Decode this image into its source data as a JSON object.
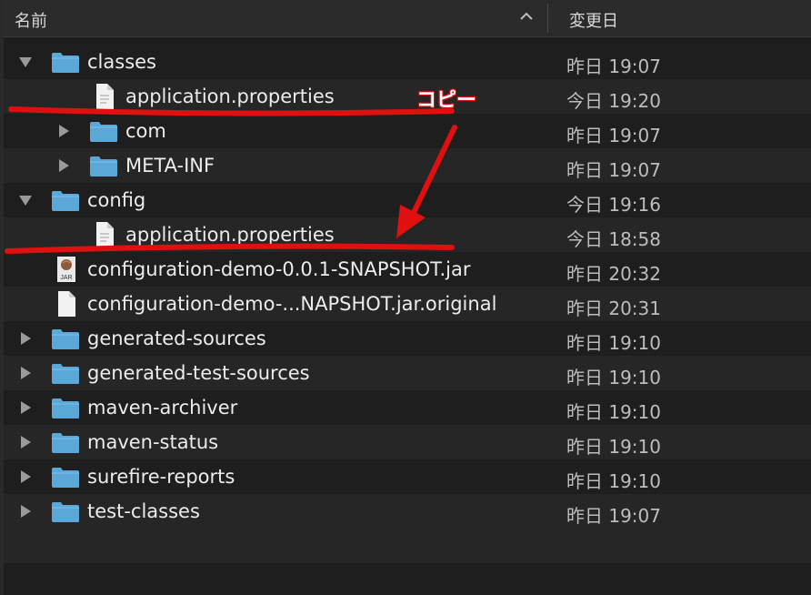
{
  "header": {
    "name_col": "名前",
    "date_col": "変更日"
  },
  "rows": [
    {
      "name": "classes",
      "date": "昨日 19:07"
    },
    {
      "name": "application.properties",
      "date": "今日 19:20"
    },
    {
      "name": "com",
      "date": "昨日 19:07"
    },
    {
      "name": "META-INF",
      "date": "昨日 19:07"
    },
    {
      "name": "config",
      "date": "今日 19:16"
    },
    {
      "name": "application.properties",
      "date": "今日 18:58"
    },
    {
      "name": "configuration-demo-0.0.1-SNAPSHOT.jar",
      "date": "昨日 20:32"
    },
    {
      "name": "configuration-demo-...NAPSHOT.jar.original",
      "date": "昨日 20:31"
    },
    {
      "name": "generated-sources",
      "date": "昨日 19:10"
    },
    {
      "name": "generated-test-sources",
      "date": "昨日 19:10"
    },
    {
      "name": "maven-archiver",
      "date": "昨日 19:10"
    },
    {
      "name": "maven-status",
      "date": "昨日 19:10"
    },
    {
      "name": "surefire-reports",
      "date": "昨日 19:10"
    },
    {
      "name": "test-classes",
      "date": "昨日 19:07"
    }
  ],
  "jar_icon_label": "JAR",
  "annotation": {
    "label": "コピー",
    "color": "#e01010"
  },
  "colors": {
    "folder": "#5ba8d8",
    "background": "#1e1e1e",
    "row_alt": "#262626"
  }
}
